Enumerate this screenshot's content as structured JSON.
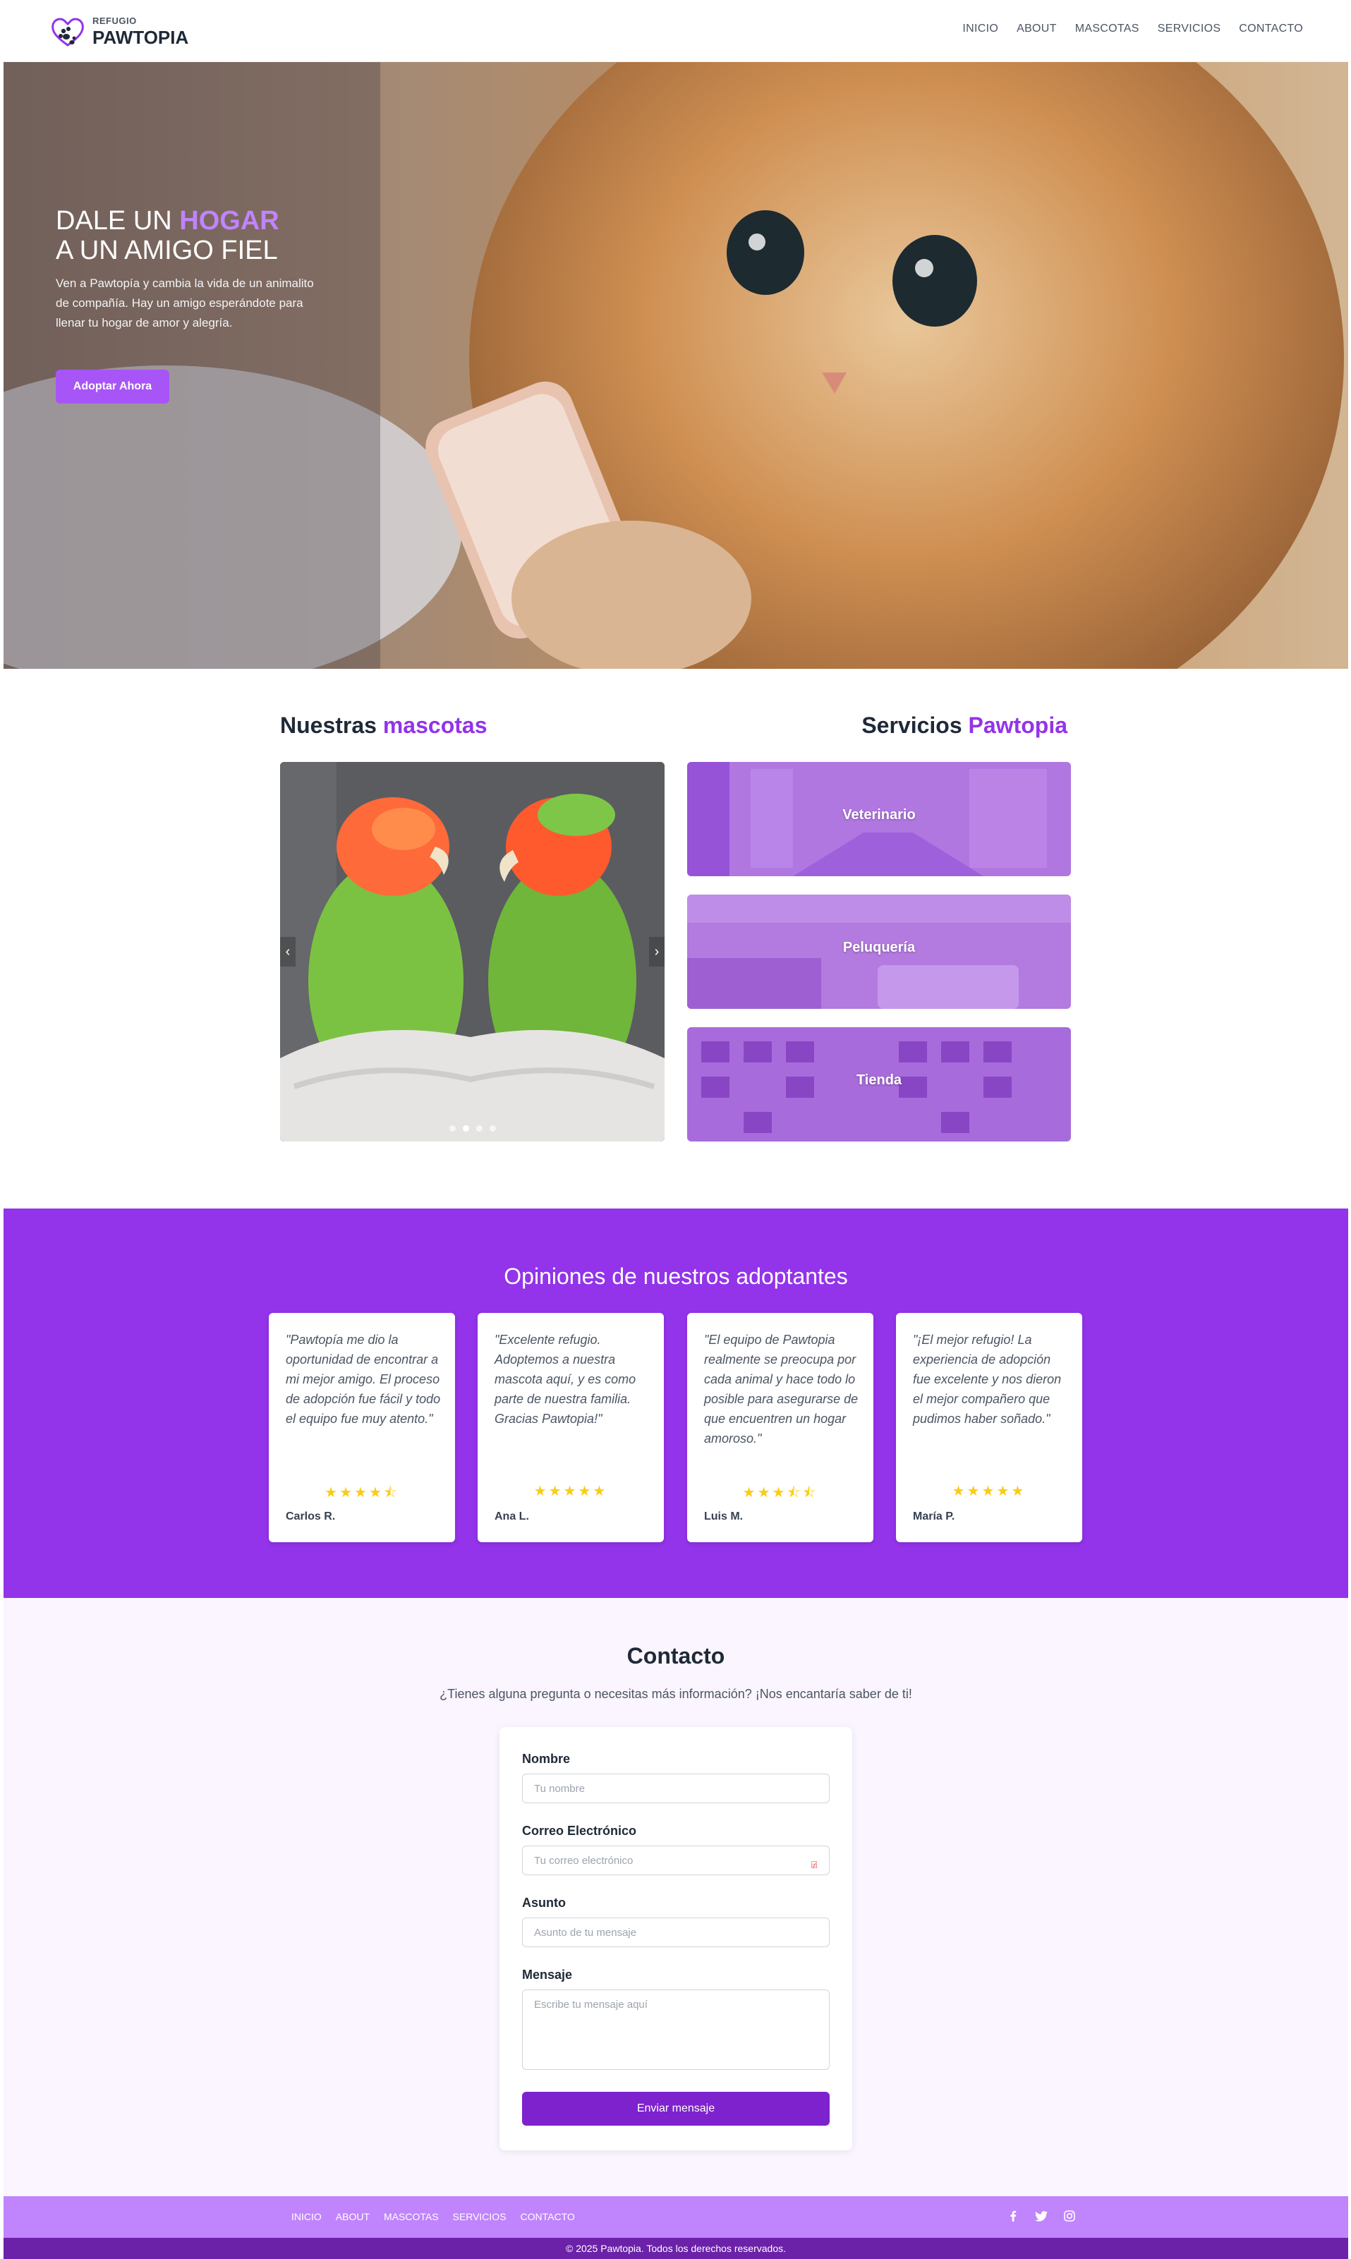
{
  "header": {
    "logo_small": "REFUGIO",
    "logo_big": "PAWTOPIA",
    "nav": [
      "INICIO",
      "ABOUT",
      "MASCOTAS",
      "SERVICIOS",
      "CONTACTO"
    ]
  },
  "hero": {
    "title_line1_a": "DALE UN",
    "title_line1_b": "HOGAR",
    "title_line2": "A UN AMIGO FIEL",
    "text": "Ven a Pawtopía y cambia la vida de un animalito de compañía. Hay un amigo esperándote para llenar tu hogar de amor y alegría.",
    "button": "Adoptar Ahora"
  },
  "pets": {
    "title_a": "Nuestras",
    "title_b": "mascotas",
    "prev": "‹",
    "next": "›",
    "dots": 4,
    "active_dot": 1
  },
  "services": {
    "title_a": "Servicios",
    "title_b": "Pawtopia",
    "items": [
      "Veterinario",
      "Peluquería",
      "Tienda"
    ]
  },
  "testimonials": {
    "title": "Opiniones de nuestros adoptantes",
    "items": [
      {
        "quote": "\"Pawtopía me dio la oportunidad de encontrar a mi mejor amigo. El proceso de adopción fue fácil y todo el equipo fue muy atento.\"",
        "stars": "★★★★⯪",
        "rating": 4.5,
        "author": "Carlos R."
      },
      {
        "quote": "\"Excelente refugio. Adoptemos a nuestra mascota aquí, y es como parte de nuestra familia. Gracias Pawtopia!\"",
        "stars": "★★★★★",
        "rating": 5,
        "author": "Ana L."
      },
      {
        "quote": "\"El equipo de Pawtopia realmente se preocupa por cada animal y hace todo lo posible para asegurarse de que encuentren un hogar amoroso.\"",
        "stars": "★★★⯪⯪",
        "rating": 3.5,
        "author": "Luis M."
      },
      {
        "quote": "\"¡El mejor refugio! La experiencia de adopción fue excelente y nos dieron el mejor compañero que pudimos haber soñado.\"",
        "stars": "★★★★★",
        "rating": 5,
        "author": "María P."
      }
    ]
  },
  "contact": {
    "title": "Contacto",
    "subtitle": "¿Tienes alguna pregunta o necesitas más información? ¡Nos encantaría saber de ti!",
    "name_label": "Nombre",
    "name_placeholder": "Tu nombre",
    "email_label": "Correo Electrónico",
    "email_placeholder": "Tu correo electrónico",
    "subject_label": "Asunto",
    "subject_placeholder": "Asunto de tu mensaje",
    "message_label": "Mensaje",
    "message_placeholder": "Escribe tu mensaje aquí",
    "button": "Enviar mensaje"
  },
  "footer": {
    "nav": [
      "INICIO",
      "ABOUT",
      "MASCOTAS",
      "SERVICIOS",
      "CONTACTO"
    ],
    "social": [
      "facebook-icon",
      "twitter-icon",
      "instagram-icon"
    ],
    "copyright": "© 2025 Pawtopia. Todos los derechos reservados."
  },
  "colors": {
    "accent": "#9333ea",
    "accent_light": "#c084fc",
    "button": "#7e22ce",
    "footer_dark": "#6b21a8"
  }
}
